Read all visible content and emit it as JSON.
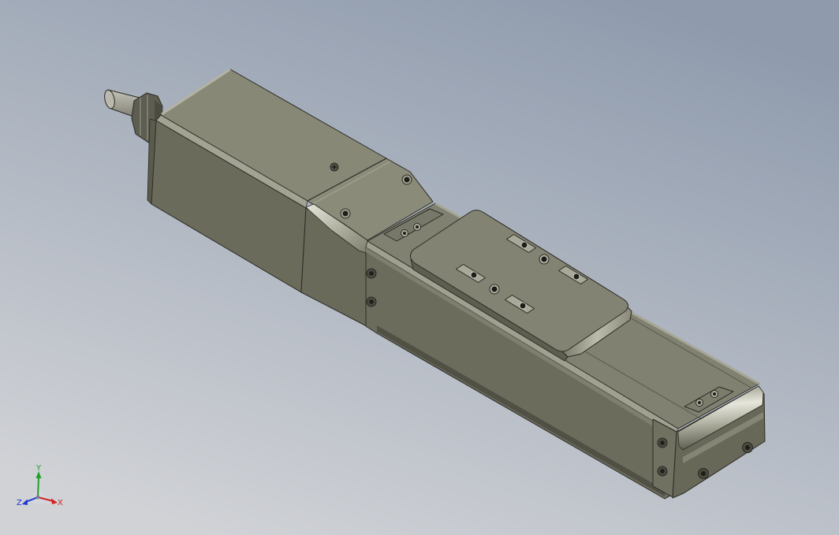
{
  "viewport": {
    "background_top": "#8f9bad",
    "background_bottom": "#d0d2d6"
  },
  "model": {
    "top_color": "#888877",
    "front_color": "#6b6b5c",
    "highlight_color": "#e4e4da",
    "edge_color": "#2a2a24"
  },
  "triad": {
    "icon": "coordinate-triad-icon",
    "x_label": "X",
    "y_label": "Y",
    "z_label": "Z",
    "x_color": "#d42222",
    "y_color": "#22a02a",
    "z_color": "#2238d2"
  }
}
